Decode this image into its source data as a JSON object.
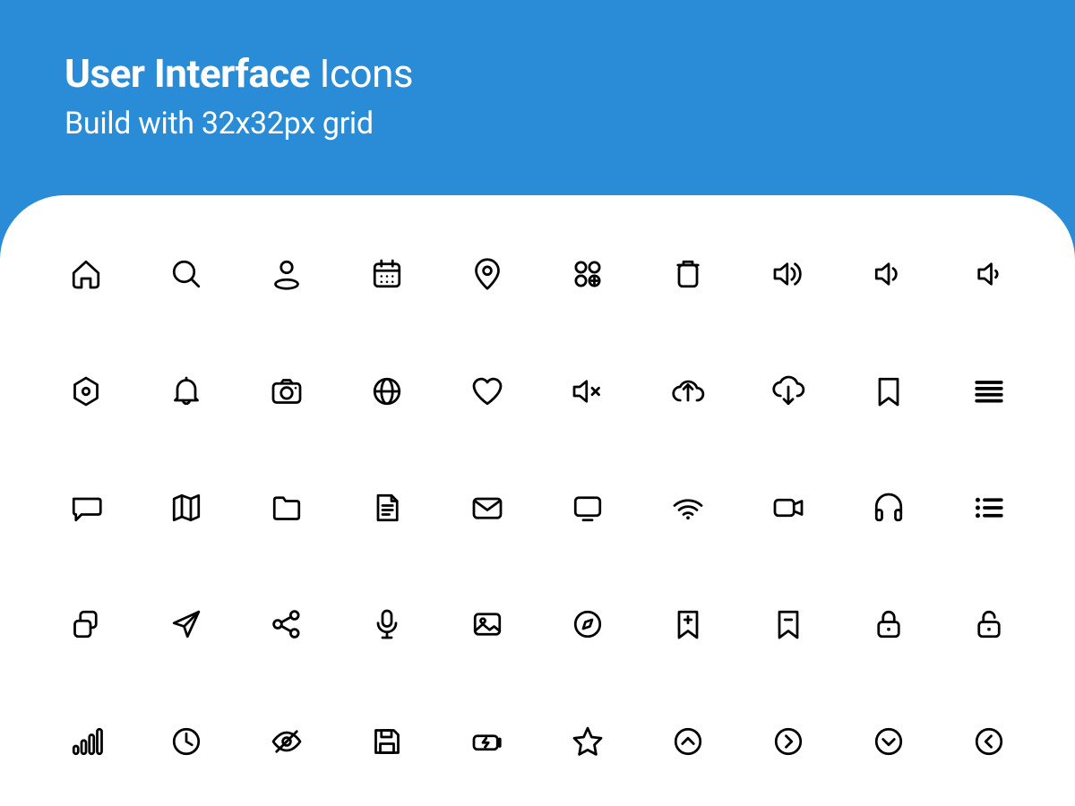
{
  "header": {
    "title_bold": "User Interface",
    "title_light": " Icons",
    "subtitle": "Build with 32x32px grid"
  },
  "colors": {
    "bg": "#2a8cd6",
    "panel": "#ffffff",
    "stroke": "#000000"
  },
  "grid_spec": "32x32px",
  "icons": [
    [
      "home",
      "search",
      "user",
      "calendar",
      "location-pin",
      "apps-add",
      "trash",
      "volume-high",
      "volume-medium",
      "volume-low"
    ],
    [
      "settings-hex",
      "bell",
      "camera",
      "globe",
      "heart",
      "volume-mute",
      "cloud-upload",
      "cloud-download",
      "bookmark",
      "menu-lines"
    ],
    [
      "chat",
      "map",
      "folder",
      "document",
      "mail",
      "monitor",
      "wifi",
      "video-camera",
      "headphones",
      "list-bullets"
    ],
    [
      "copy",
      "send",
      "share",
      "microphone",
      "image",
      "compass",
      "bookmark-add",
      "bookmark-remove",
      "lock",
      "unlock"
    ],
    [
      "signal-bars",
      "clock",
      "eye-off",
      "save",
      "battery-charging",
      "star",
      "chevron-up-circle",
      "chevron-right-circle",
      "chevron-down-circle",
      "chevron-left-circle"
    ]
  ]
}
